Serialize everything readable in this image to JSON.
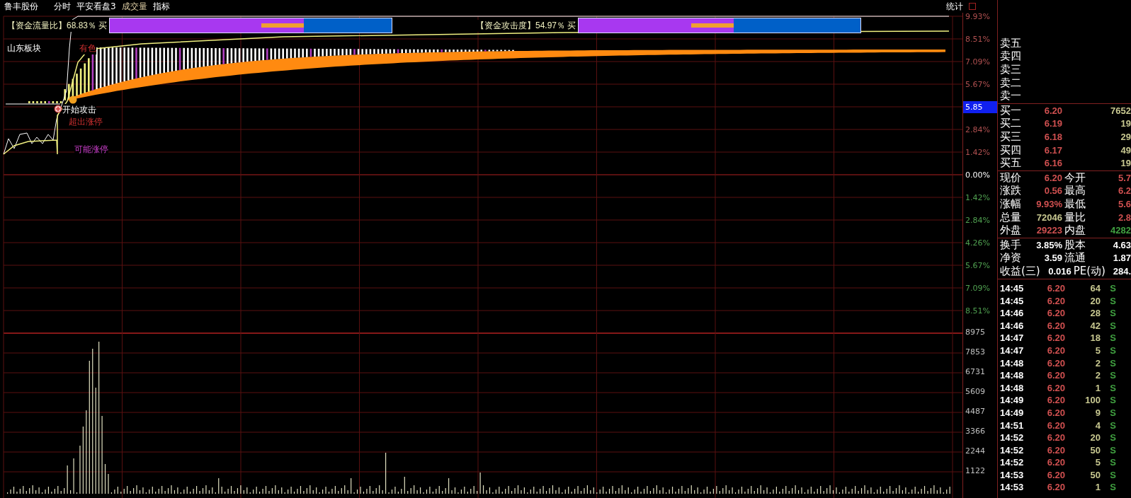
{
  "header": {
    "stock_name": "鲁丰股份",
    "items": [
      {
        "label": "分时",
        "selected": false
      },
      {
        "label": "平安看盘3",
        "selected": false
      },
      {
        "label": "成交量",
        "selected": true
      },
      {
        "label": "指标",
        "selected": false
      }
    ],
    "stats_button": "统计"
  },
  "indicators": [
    {
      "label": "【资金流量比】",
      "reading": "68.83％ 买",
      "level": 0.6883
    },
    {
      "label": "【资金攻击度】",
      "reading": "54.97％ 买",
      "level": 0.5497
    }
  ],
  "chart_labels": [
    {
      "text": "山东板块",
      "kind": "sector"
    },
    {
      "text": "有色",
      "kind": "industry"
    },
    {
      "text": "开始攻击",
      "kind": "signal"
    },
    {
      "text": "超出涨停",
      "kind": "alert"
    },
    {
      "text": "可能涨停",
      "kind": "forecast"
    }
  ],
  "price_axis": [
    {
      "label": "9.93%",
      "kind": "up"
    },
    {
      "label": "8.51%",
      "kind": "up"
    },
    {
      "label": "7.09%",
      "kind": "up"
    },
    {
      "label": "5.67%",
      "kind": "up"
    },
    {
      "label": "5.85",
      "kind": "marker"
    },
    {
      "label": "2.84%",
      "kind": "up"
    },
    {
      "label": "1.42%",
      "kind": "up"
    },
    {
      "label": "0.00%",
      "kind": "zero"
    },
    {
      "label": "1.42%",
      "kind": "down"
    },
    {
      "label": "2.84%",
      "kind": "down"
    },
    {
      "label": "4.26%",
      "kind": "down"
    },
    {
      "label": "5.67%",
      "kind": "down"
    },
    {
      "label": "7.09%",
      "kind": "down"
    },
    {
      "label": "8.51%",
      "kind": "down"
    }
  ],
  "volume_axis": [
    "8975",
    "7853",
    "6731",
    "5609",
    "4487",
    "3366",
    "2244",
    "1122"
  ],
  "order_book": {
    "sell": [
      {
        "label": "卖五"
      },
      {
        "label": "卖四"
      },
      {
        "label": "卖三"
      },
      {
        "label": "卖二"
      },
      {
        "label": "卖一"
      }
    ],
    "buy": [
      {
        "label": "买一",
        "price": "6.20",
        "volume": "7652"
      },
      {
        "label": "买二",
        "price": "6.19",
        "volume": "19"
      },
      {
        "label": "买三",
        "price": "6.18",
        "volume": "29"
      },
      {
        "label": "买四",
        "price": "6.17",
        "volume": "49"
      },
      {
        "label": "买五",
        "price": "6.16",
        "volume": "19"
      }
    ]
  },
  "quote": [
    {
      "left": {
        "label": "现价",
        "value": "6.20",
        "color": "#d05050"
      },
      "right": {
        "label": "今开",
        "value": "5.7",
        "color": "#d05050"
      }
    },
    {
      "left": {
        "label": "涨跌",
        "value": "0.56",
        "color": "#d05050"
      },
      "right": {
        "label": "最高",
        "value": "6.2",
        "color": "#d05050"
      }
    },
    {
      "left": {
        "label": "涨幅",
        "value": "9.93%",
        "color": "#d05050"
      },
      "right": {
        "label": "最低",
        "value": "5.6",
        "color": "#d05050"
      }
    },
    {
      "left": {
        "label": "总量",
        "value": "72046",
        "color": "#c8c890"
      },
      "right": {
        "label": "量比",
        "value": "2.8",
        "color": "#d05050"
      }
    },
    {
      "left": {
        "label": "外盘",
        "value": "29223",
        "color": "#d05050"
      },
      "right": {
        "label": "内盘",
        "value": "4282",
        "color": "#40a040"
      }
    }
  ],
  "stats": [
    {
      "label": "换手",
      "value": "3.85%",
      "label_2": "股本",
      "value_2": "4.63"
    },
    {
      "label": "净资",
      "value": "3.59",
      "label_2": "流通",
      "value_2": "1.87"
    },
    {
      "label": "收益(三)",
      "value": "0.016",
      "label_2": "PE(动)",
      "value_2": "284."
    }
  ],
  "ticks": [
    {
      "time": "14:45",
      "price": "6.20",
      "volume": "64",
      "side": "S"
    },
    {
      "time": "14:45",
      "price": "6.20",
      "volume": "20",
      "side": "S"
    },
    {
      "time": "14:46",
      "price": "6.20",
      "volume": "28",
      "side": "S"
    },
    {
      "time": "14:46",
      "price": "6.20",
      "volume": "42",
      "side": "S"
    },
    {
      "time": "14:47",
      "price": "6.20",
      "volume": "18",
      "side": "S"
    },
    {
      "time": "14:47",
      "price": "6.20",
      "volume": "5",
      "side": "S"
    },
    {
      "time": "14:48",
      "price": "6.20",
      "volume": "2",
      "side": "S"
    },
    {
      "time": "14:48",
      "price": "6.20",
      "volume": "2",
      "side": "S"
    },
    {
      "time": "14:48",
      "price": "6.20",
      "volume": "1",
      "side": "S"
    },
    {
      "time": "14:49",
      "price": "6.20",
      "volume": "100",
      "side": "S"
    },
    {
      "time": "14:49",
      "price": "6.20",
      "volume": "9",
      "side": "S"
    },
    {
      "time": "14:51",
      "price": "6.20",
      "volume": "4",
      "side": "S"
    },
    {
      "time": "14:52",
      "price": "6.20",
      "volume": "20",
      "side": "S"
    },
    {
      "time": "14:52",
      "price": "6.20",
      "volume": "50",
      "side": "S"
    },
    {
      "time": "14:52",
      "price": "6.20",
      "volume": "5",
      "side": "S"
    },
    {
      "time": "14:53",
      "price": "6.20",
      "volume": "50",
      "side": "S"
    },
    {
      "time": "14:53",
      "price": "6.20",
      "volume": "1",
      "side": "S"
    }
  ]
}
